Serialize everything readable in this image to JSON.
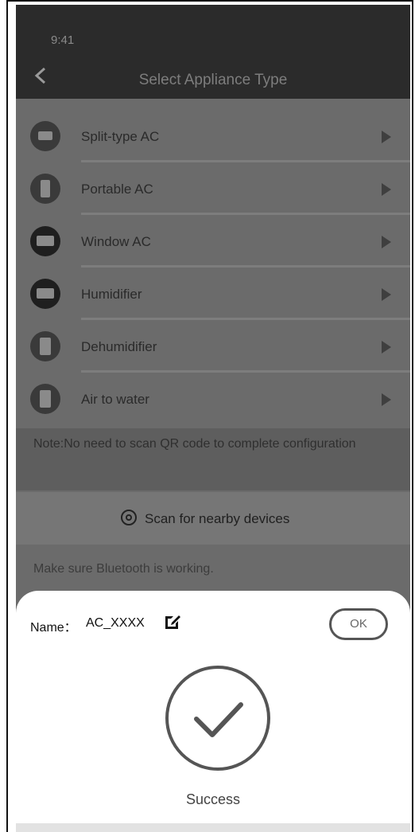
{
  "status_bar": {
    "time": "9:41"
  },
  "header": {
    "title": "Select Appliance Type",
    "back_icon": "chevron-left-icon"
  },
  "appliances": [
    {
      "label": "Split-type AC",
      "icon": "split-ac-icon"
    },
    {
      "label": "Portable AC",
      "icon": "portable-ac-icon"
    },
    {
      "label": "Window AC",
      "icon": "window-ac-icon"
    },
    {
      "label": "Humidifier",
      "icon": "humidifier-icon"
    },
    {
      "label": "Dehumidifier",
      "icon": "dehumidifier-icon"
    },
    {
      "label": "Air to water",
      "icon": "air-to-water-icon"
    }
  ],
  "note": {
    "text": "Note:No need to scan QR code to complete configuration"
  },
  "scan": {
    "label": "Scan for nearby devices",
    "icon": "scan-icon"
  },
  "hint": {
    "text": "Make sure Bluetooth is working."
  },
  "sheet": {
    "name_label": "Name：",
    "name_value": "AC_XXXX",
    "ok_label": "OK",
    "status": "Success",
    "edit_icon": "edit-icon",
    "check_icon": "checkmark-circle-icon"
  }
}
